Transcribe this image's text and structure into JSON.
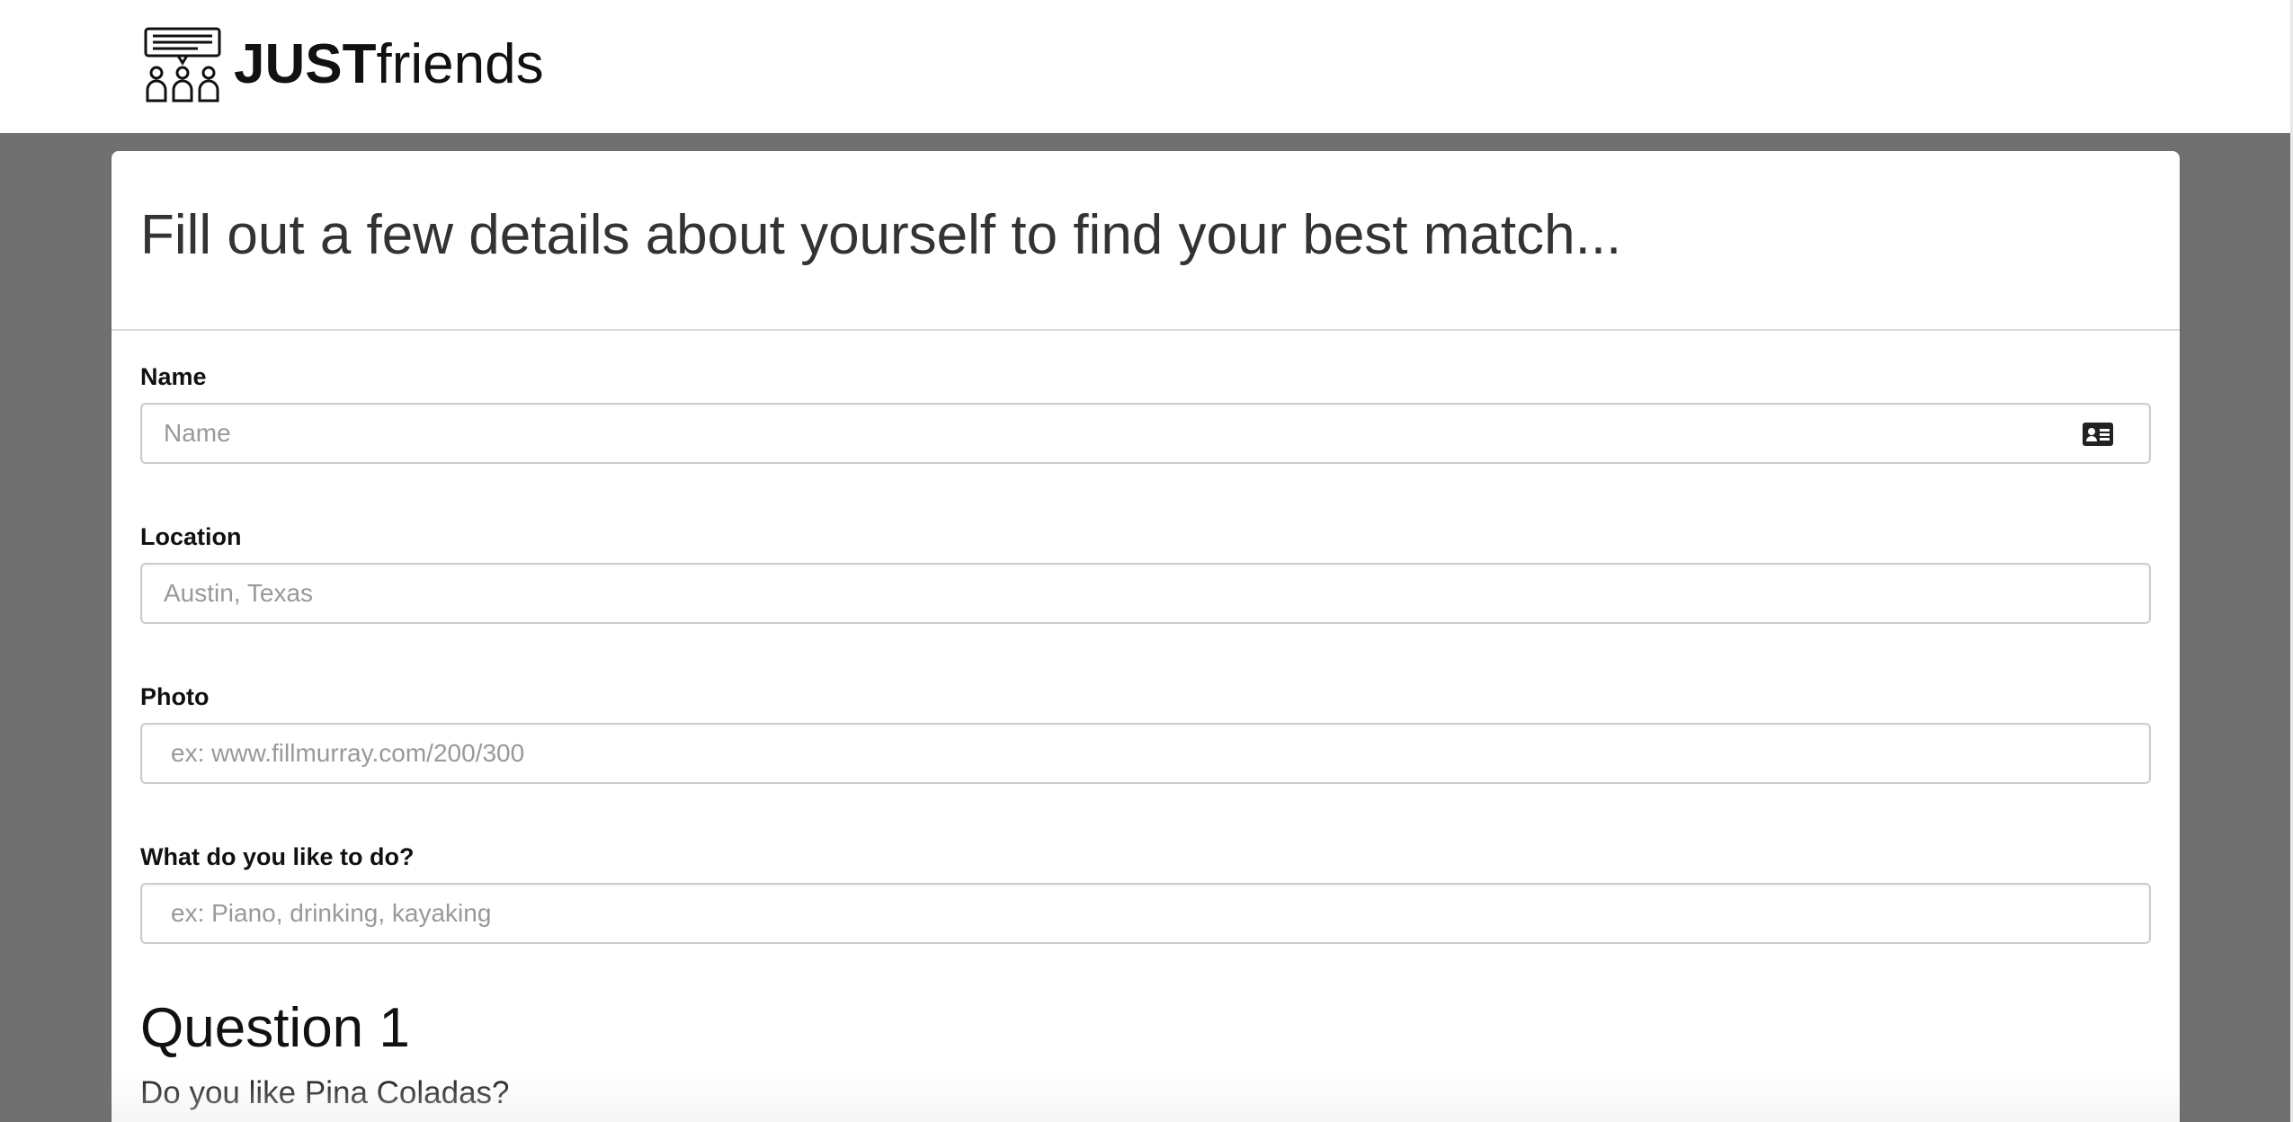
{
  "brand": {
    "name_bold": "JUST",
    "name_light": "friends",
    "logo_icon": "group-chat-icon"
  },
  "form": {
    "heading": "Fill out a few details about yourself to find your best match...",
    "fields": [
      {
        "label": "Name",
        "placeholder": "Name",
        "value": "",
        "icon": "id-card-icon"
      },
      {
        "label": "Location",
        "placeholder": "Austin, Texas",
        "value": ""
      },
      {
        "label": "Photo",
        "placeholder": "ex: www.fillmurray.com/200/300",
        "value": ""
      },
      {
        "label": "What do you like to do?",
        "placeholder": "ex: Piano, drinking, kayaking",
        "value": ""
      }
    ],
    "questions": [
      {
        "heading": "Question 1",
        "text": "Do you like Pina Coladas?"
      }
    ]
  },
  "colors": {
    "page_background": "#707070",
    "panel_background": "#ffffff",
    "header_background": "#ffffff",
    "input_border": "#cccccc",
    "placeholder_text": "#999999"
  }
}
